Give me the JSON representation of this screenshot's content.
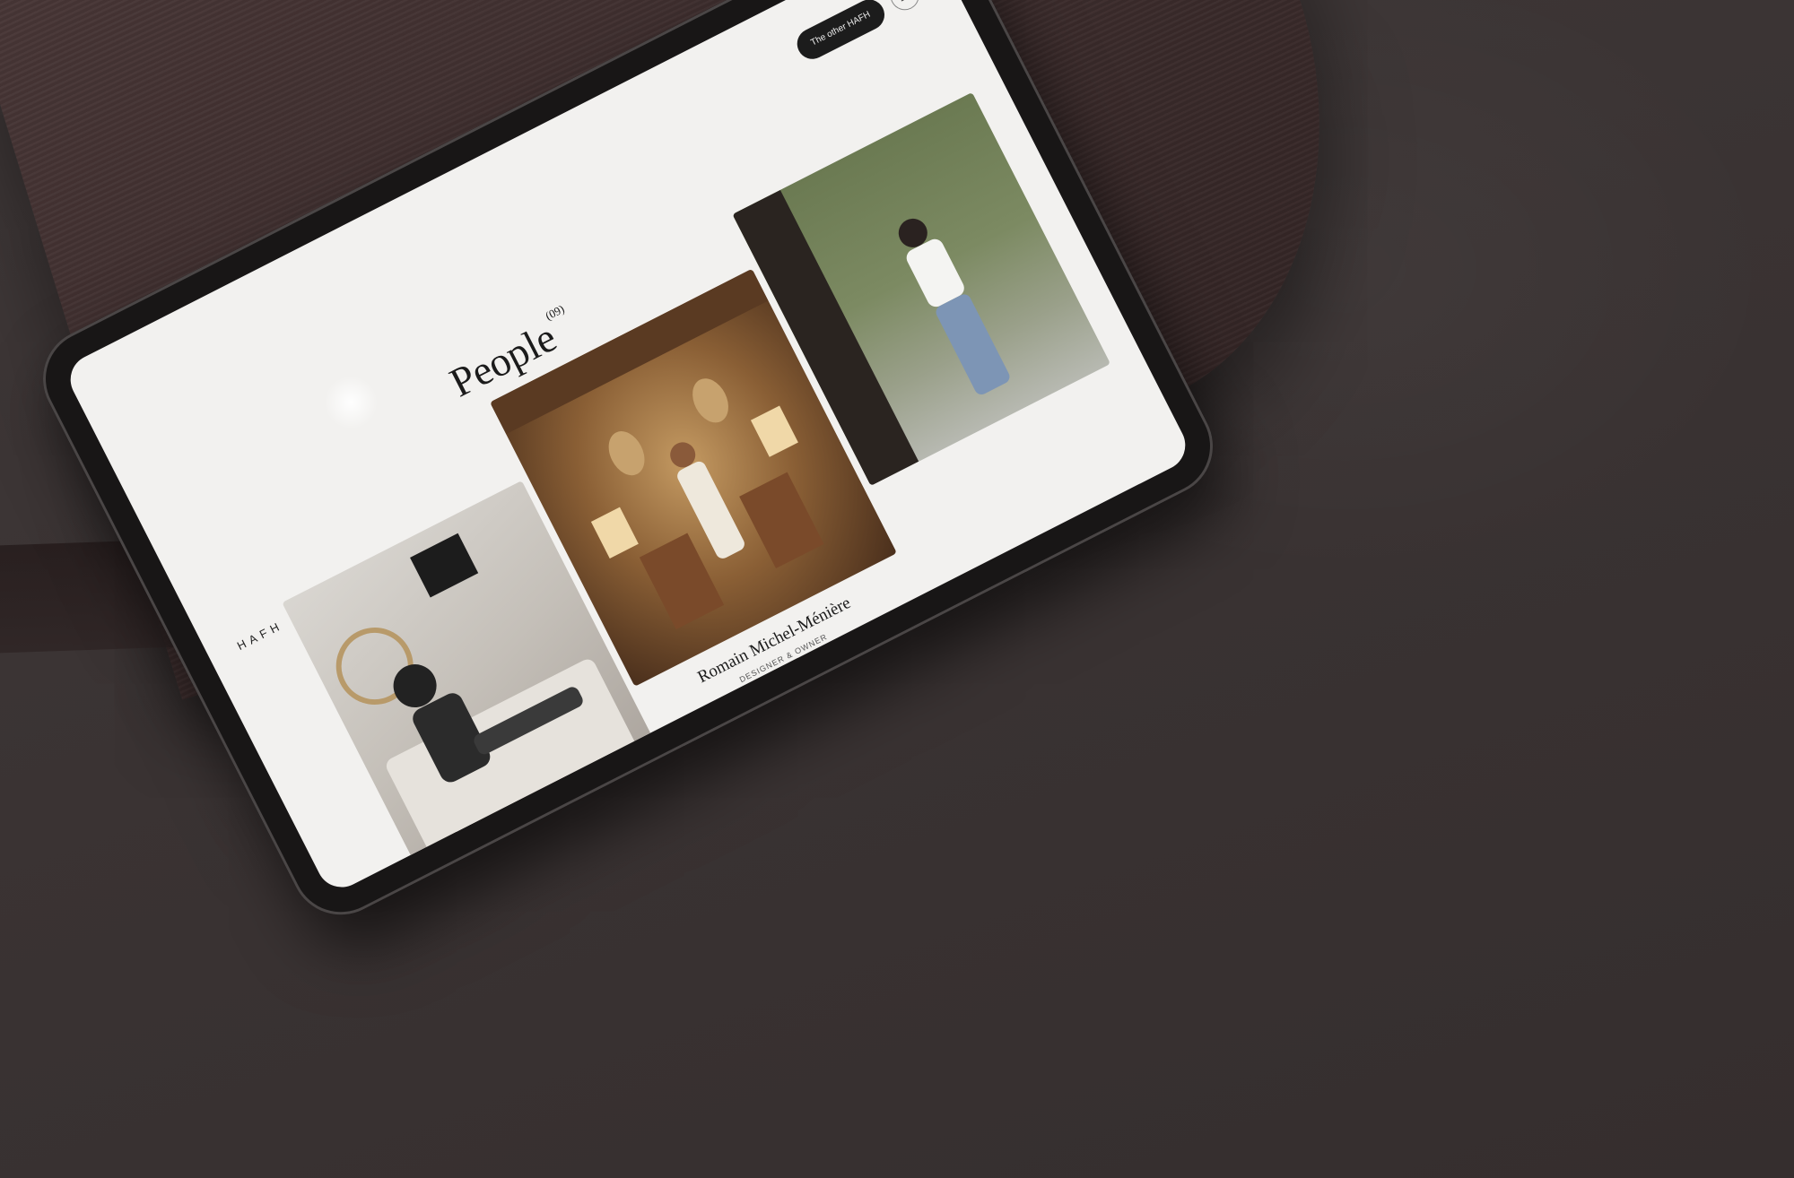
{
  "header": {
    "brand": "HAFH",
    "other_link": "The other HAFH"
  },
  "section": {
    "title": "People",
    "count": "(09)"
  },
  "photos": [
    {
      "subject": "woman-reading-on-sofa"
    },
    {
      "subject": "man-in-dining-room"
    },
    {
      "subject": "woman-at-door"
    }
  ],
  "featured": {
    "name": "Romain Michel-Ménière",
    "role": "DESIGNER & OWNER"
  }
}
